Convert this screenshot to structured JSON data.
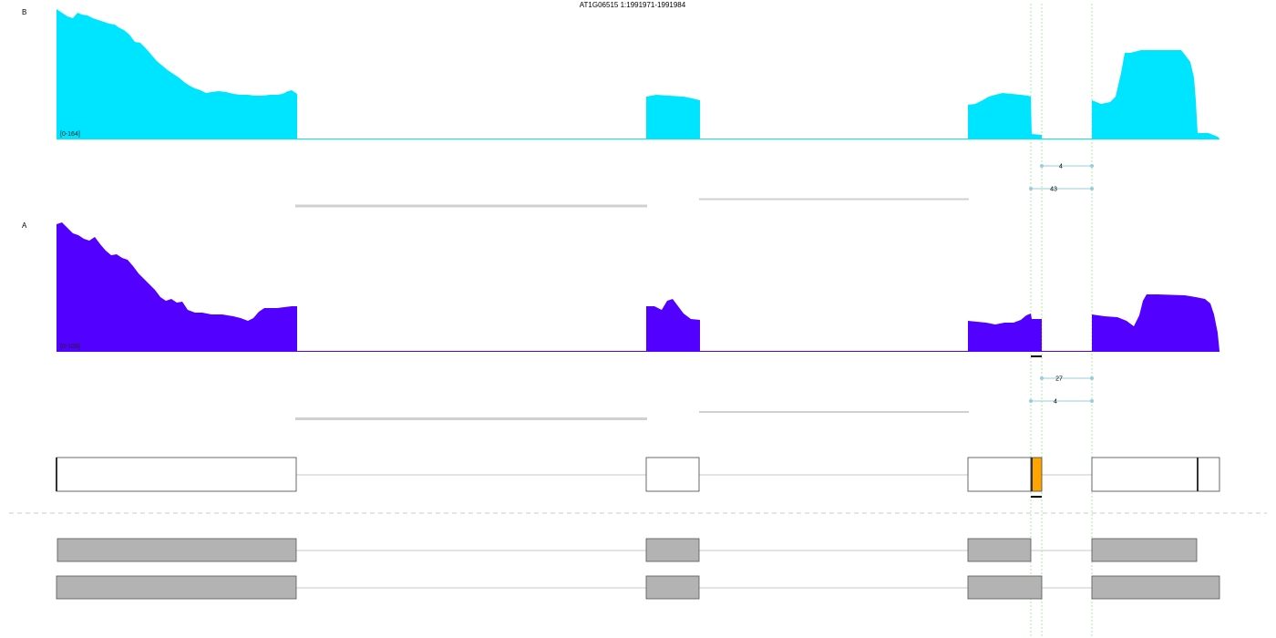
{
  "title": "AT1G06515 1:1991971-1991984",
  "colors": {
    "track_B": "#00e5ff",
    "track_A": "#5200ff",
    "junction": "#99ccdd",
    "highlight": "#ffa500",
    "gene_fill": "#b3b3b3",
    "guide": "#33cc33"
  },
  "tracks": [
    {
      "label": "B",
      "range_label": "[0-164]",
      "max": 164,
      "junctions": [
        {
          "count": "4"
        },
        {
          "count": "43"
        }
      ]
    },
    {
      "label": "A",
      "range_label": "[0-108]",
      "max": 108,
      "junctions": [
        {
          "count": "27"
        },
        {
          "count": "4"
        }
      ]
    }
  ]
}
